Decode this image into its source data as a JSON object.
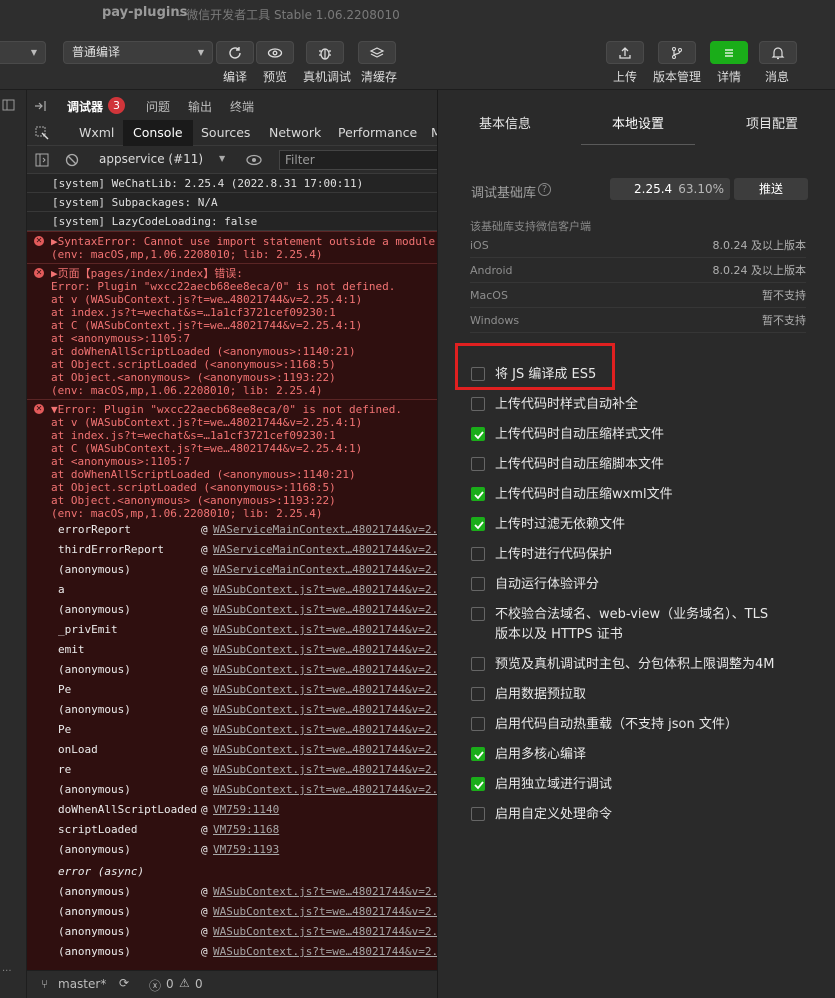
{
  "window": {
    "app_name": "pay-plugins",
    "subtitle": "- 微信开发者工具 Stable 1.06.2208010"
  },
  "toolbar": {
    "compile_mode": "普通编译",
    "labels": {
      "compile": "编译",
      "preview": "预览",
      "real_debug": "真机调试",
      "clear_cache": "清缓存",
      "upload": "上传",
      "version": "版本管理",
      "details": "详情",
      "messages": "消息"
    }
  },
  "debugger": {
    "tabs_top": [
      "调试器",
      "问题",
      "输出",
      "终端"
    ],
    "badge_count": "3",
    "tabs_devtools": [
      "Wxml",
      "Console",
      "Sources",
      "Network",
      "Performance",
      "M"
    ],
    "context": "appservice (#11)",
    "filter_placeholder": "Filter",
    "system_lines": [
      "[system] WeChatLib: 2.25.4 (2022.8.31 17:00:11)",
      "[system] Subpackages: N/A",
      "[system] LazyCodeLoading: false"
    ],
    "error1": {
      "line1": "▶SyntaxError: Cannot use import statement outside a module",
      "line2": "(env: macOS,mp,1.06.2208010; lib: 2.25.4)"
    },
    "error2": {
      "lines": [
        "▶页面【pages/index/index】错误:",
        " Error: Plugin \"wxcc22aecb68ee8eca/0\" is not defined.",
        "    at v (WASubContext.js?t=we…48021744&v=2.25.4:1)",
        "    at index.js?t=wechat&s=…1a1cf3721cef09230:1",
        "    at C (WASubContext.js?t=we…48021744&v=2.25.4:1)",
        "    at <anonymous>:1105:7",
        "    at doWhenAllScriptLoaded (<anonymous>:1140:21)",
        "    at Object.scriptLoaded (<anonymous>:1168:5)",
        "    at Object.<anonymous> (<anonymous>:1193:22)",
        "(env: macOS,mp,1.06.2208010; lib: 2.25.4)"
      ]
    },
    "error3": {
      "lines": [
        "▼Error: Plugin \"wxcc22aecb68ee8eca/0\" is not defined.",
        "    at v (WASubContext.js?t=we…48021744&v=2.25.4:1)",
        "    at index.js?t=wechat&s=…1a1cf3721cef09230:1",
        "    at C (WASubContext.js?t=we…48021744&v=2.25.4:1)",
        "    at <anonymous>:1105:7",
        "    at doWhenAllScriptLoaded (<anonymous>:1140:21)",
        "    at Object.scriptLoaded (<anonymous>:1168:5)",
        "    at Object.<anonymous> (<anonymous>:1193:22)",
        "(env: macOS,mp,1.06.2208010; lib: 2.25.4)"
      ]
    },
    "stack": [
      {
        "fn": "errorReport",
        "loc": "WAServiceMainContext…48021744&v=2."
      },
      {
        "fn": "thirdErrorReport",
        "loc": "WAServiceMainContext…48021744&v=2."
      },
      {
        "fn": "(anonymous)",
        "loc": "WAServiceMainContext…48021744&v=2."
      },
      {
        "fn": "a",
        "loc": "WASubContext.js?t=we…48021744&v=2."
      },
      {
        "fn": "(anonymous)",
        "loc": "WASubContext.js?t=we…48021744&v=2."
      },
      {
        "fn": "_privEmit",
        "loc": "WASubContext.js?t=we…48021744&v=2."
      },
      {
        "fn": "emit",
        "loc": "WASubContext.js?t=we…48021744&v=2."
      },
      {
        "fn": "(anonymous)",
        "loc": "WASubContext.js?t=we…48021744&v=2."
      },
      {
        "fn": "Pe",
        "loc": "WASubContext.js?t=we…48021744&v=2."
      },
      {
        "fn": "(anonymous)",
        "loc": "WASubContext.js?t=we…48021744&v=2."
      },
      {
        "fn": "Pe",
        "loc": "WASubContext.js?t=we…48021744&v=2."
      },
      {
        "fn": "onLoad",
        "loc": "WASubContext.js?t=we…48021744&v=2."
      },
      {
        "fn": "re",
        "loc": "WASubContext.js?t=we…48021744&v=2."
      },
      {
        "fn": "(anonymous)",
        "loc": "WASubContext.js?t=we…48021744&v=2."
      },
      {
        "fn": "doWhenAllScriptLoaded",
        "loc": "VM759:1140"
      },
      {
        "fn": "scriptLoaded",
        "loc": "VM759:1168"
      },
      {
        "fn": "(anonymous)",
        "loc": "VM759:1193"
      }
    ],
    "async_label": "error (async)",
    "stack_async": [
      {
        "fn": "(anonymous)",
        "loc": "WASubContext.js?t=we…48021744&v=2."
      },
      {
        "fn": "(anonymous)",
        "loc": "WASubContext.js?t=we…48021744&v=2."
      },
      {
        "fn": "(anonymous)",
        "loc": "WASubContext.js?t=we…48021744&v=2."
      },
      {
        "fn": "(anonymous)",
        "loc": "WASubContext.js?t=we…48021744&v=2."
      }
    ],
    "at_symbol": "@"
  },
  "statusbar": {
    "branch": "master*",
    "errors": "0",
    "warnings": "0"
  },
  "settings": {
    "tabs": [
      "基本信息",
      "本地设置",
      "项目配置"
    ],
    "lib_label": "调试基础库",
    "lib_version": "2.25.4",
    "lib_percent": "63.10%",
    "push_label": "推送",
    "support_note": "该基础库支持微信客户端",
    "platforms": [
      {
        "name": "iOS",
        "req": "8.0.24 及以上版本"
      },
      {
        "name": "Android",
        "req": "8.0.24 及以上版本"
      },
      {
        "name": "MacOS",
        "req": "暂不支持"
      },
      {
        "name": "Windows",
        "req": "暂不支持"
      }
    ],
    "options": [
      {
        "label": "将 JS 编译成 ES5",
        "checked": false
      },
      {
        "label": "上传代码时样式自动补全",
        "checked": false
      },
      {
        "label": "上传代码时自动压缩样式文件",
        "checked": true
      },
      {
        "label": "上传代码时自动压缩脚本文件",
        "checked": false
      },
      {
        "label": "上传代码时自动压缩wxml文件",
        "checked": true
      },
      {
        "label": "上传时过滤无依赖文件",
        "checked": true
      },
      {
        "label": "上传时进行代码保护",
        "checked": false
      },
      {
        "label": "自动运行体验评分",
        "checked": false
      },
      {
        "label": "不校验合法域名、web-view（业务域名）、TLS",
        "label2": "版本以及 HTTPS 证书",
        "checked": false
      },
      {
        "label": "预览及真机调试时主包、分包体积上限调整为4M",
        "checked": false
      },
      {
        "label": "启用数据预拉取",
        "checked": false
      },
      {
        "label": "启用代码自动热重载（不支持 json 文件）",
        "checked": false
      },
      {
        "label": "启用多核心编译",
        "checked": true
      },
      {
        "label": "启用独立域进行调试",
        "checked": true
      },
      {
        "label": "启用自定义处理命令",
        "checked": false
      }
    ],
    "accent": "#1aad19",
    "highlight_color": "#e02020"
  }
}
